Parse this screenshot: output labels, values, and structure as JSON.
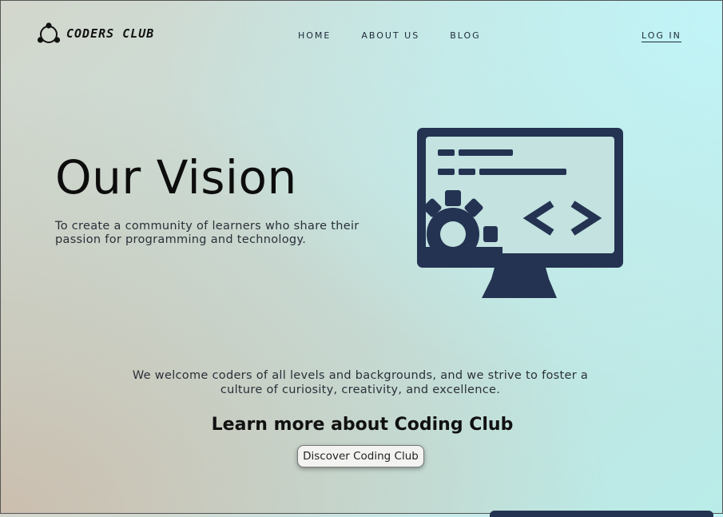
{
  "nav": {
    "logo_text": "CODERS CLUB",
    "logo_icon": "network-nodes-icon",
    "links": [
      "HOME",
      "ABOUT US",
      "BLOG"
    ],
    "login_label": "LOG IN"
  },
  "hero": {
    "title": "Our Vision",
    "subtitle": "To create a community of learners who share their passion for programming and technology.",
    "illustration_icon": "monitor-code-icon"
  },
  "about": {
    "welcome": "We welcome coders of all levels and backgrounds, and we strive to foster a culture of curiosity, creativity, and excellence.",
    "heading": "Learn more about Coding Club",
    "button_label": "Discover Coding Club"
  },
  "colors": {
    "accent": "#243352",
    "text": "#1b1b1b"
  }
}
